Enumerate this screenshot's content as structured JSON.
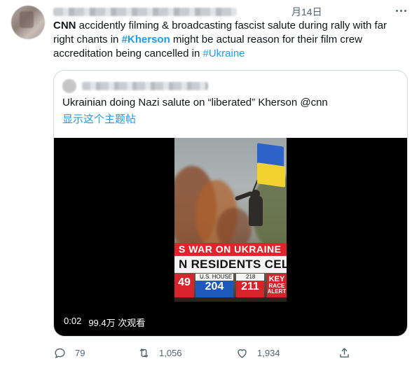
{
  "tweet": {
    "date": "月14日",
    "text_parts": {
      "lead": "CNN",
      "t1": " accidently filming & broadcasting fascist salute during rally with far right chants in ",
      "tag1": "#Kherson",
      "t2": " might be actual reason for their film crew accreditation being cancelled in ",
      "tag2": "#Ukraine"
    }
  },
  "quote": {
    "text": "Ukrainian doing Nazi salute on “liberated” Kherson @cnn",
    "show_thread": "显示这个主题帖",
    "video": {
      "time": "0:02",
      "views": "99.4万 次观看",
      "banner_top": "S WAR ON UKRAINE",
      "banner_main": "N RESIDENTS CELEBR",
      "tally": {
        "left_num": "49",
        "house_label": "U.S. HOUSE",
        "blue_num": "204",
        "red_label": "218",
        "red_num": "211",
        "key_line1": "KEY",
        "key_line2": "RACE",
        "key_line3": "ALERT"
      }
    }
  },
  "actions": {
    "replies": "79",
    "retweets": "1,056",
    "likes": "1,934"
  },
  "colors": {
    "accent": "#1d9bf0",
    "muted": "#536471",
    "border": "#cfd9de"
  },
  "icons": [
    "more-icon",
    "reply-icon",
    "retweet-icon",
    "like-icon",
    "share-icon"
  ]
}
